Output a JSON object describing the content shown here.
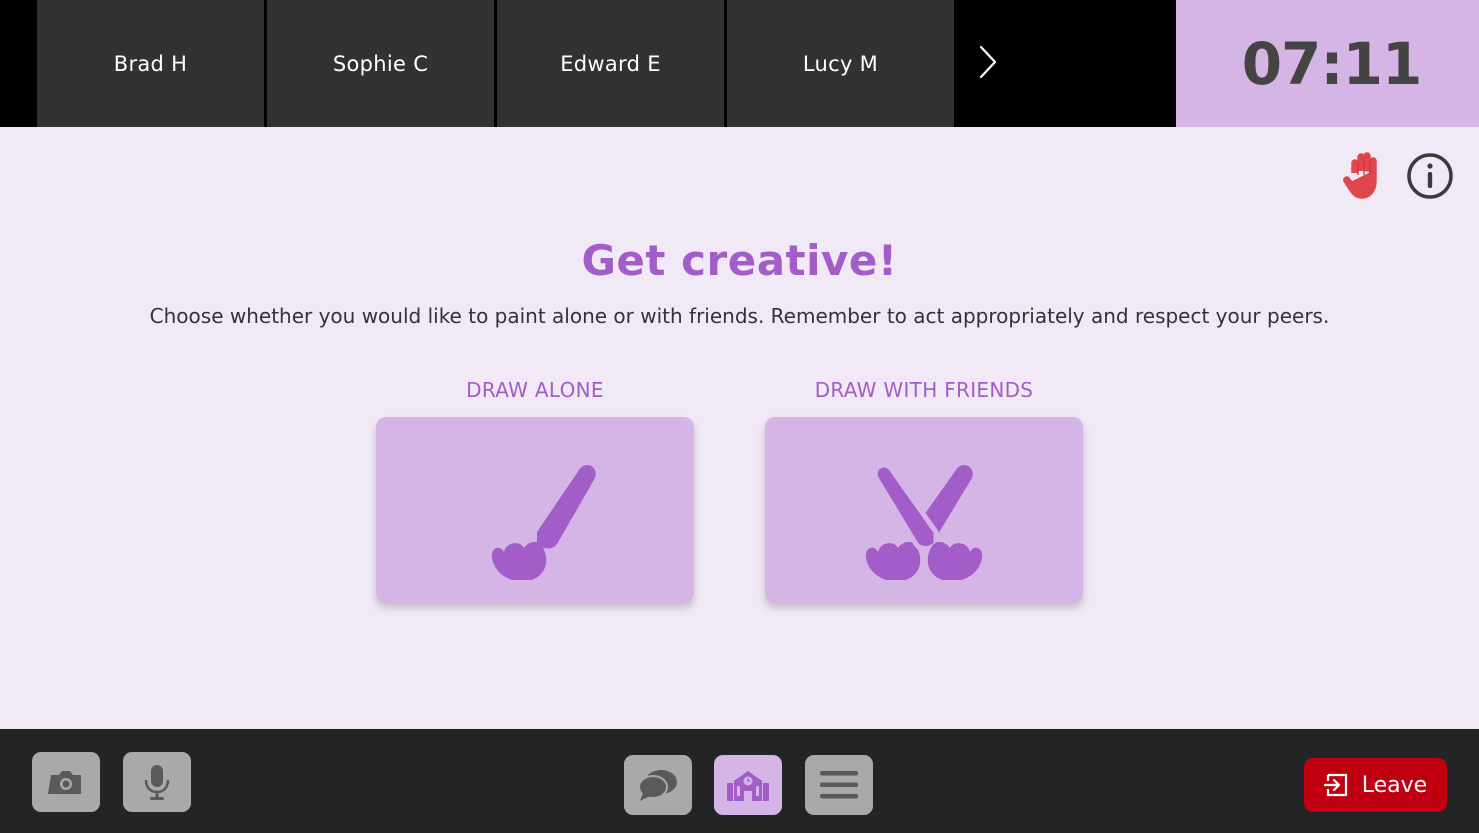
{
  "participants": [
    "Brad H",
    "Sophie C",
    "Edward E",
    "Lucy M"
  ],
  "timer": "07:11",
  "main": {
    "title": "Get creative!",
    "subtitle": "Choose whether you would like to paint alone or with friends. Remember to act appropriately and respect your peers.",
    "options": [
      {
        "label": "DRAW ALONE",
        "icon": "paintbrush-icon"
      },
      {
        "label": "DRAW WITH FRIENDS",
        "icon": "crossed-paintbrushes-icon"
      }
    ]
  },
  "icons": {
    "next": "chevron-right-icon",
    "hand": "raise-hand-icon",
    "info": "info-icon",
    "camera": "camera-icon",
    "mic": "microphone-icon",
    "chat": "chat-icon",
    "school": "school-icon",
    "menu": "menu-icon",
    "leave": "exit-icon"
  },
  "toolbar": {
    "leave_label": "Leave"
  },
  "colors": {
    "accent": "#a35dc8",
    "accent_light": "#d4b5e6",
    "background": "#f1e9f6",
    "hand": "#e0474c",
    "leave": "#c00010"
  }
}
